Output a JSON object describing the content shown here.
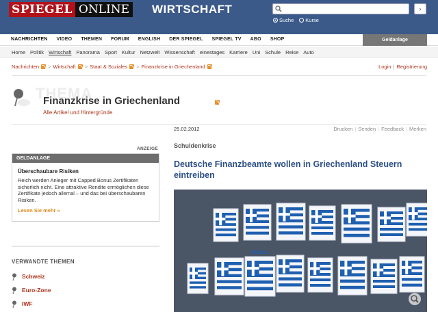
{
  "header": {
    "logo_left": "SPIEGEL",
    "logo_right": "ONLINE",
    "section": "WIRTSCHAFT",
    "search": {
      "placeholder": "",
      "button": "›"
    },
    "radios": [
      {
        "label": "Suche",
        "selected": true
      },
      {
        "label": "Kurse",
        "selected": false
      }
    ]
  },
  "mainnav": {
    "items": [
      "NACHRICHTEN",
      "VIDEO",
      "THEMEN",
      "FORUM",
      "ENGLISH",
      "DER SPIEGEL",
      "SPIEGEL TV",
      "ABO",
      "SHOP"
    ],
    "active": "NACHRICHTEN",
    "right_tab": "Geldanlage"
  },
  "subnav": {
    "items": [
      "Home",
      "Politik",
      "Wirtschaft",
      "Panorama",
      "Sport",
      "Kultur",
      "Netzwelt",
      "Wissenschaft",
      "einestages",
      "Karriere",
      "Uni",
      "Schule",
      "Reise",
      "Auto"
    ],
    "active": "Wirtschaft"
  },
  "breadcrumb": [
    "Nachrichten",
    "Wirtschaft",
    "Staat & Soziales",
    "Finanzkrise in Griechenland"
  ],
  "account": {
    "login": "Login",
    "register": "Registrierung"
  },
  "thema": {
    "badge": "THEMA",
    "title": "Finanzkrise in Griechenland",
    "subtitle": "Alle Artikel und Hintergründe"
  },
  "article_meta": {
    "date": "25.02.2012",
    "tools": [
      "Drucken",
      "Senden",
      "Feedback",
      "Merken"
    ]
  },
  "ad": {
    "label": "ANZEIGE",
    "header": "GELDANLAGE",
    "title": "Überschaubare Risiken",
    "text": "Reich werden Anleger mit Capped Bonus Zertifikaten sicherlich nicht. Eine attraktive Rendite ermöglichen diese Zertifikate jedoch allemal – und das bei überschaubaren Risiken.",
    "more": "Lesen Sie mehr »"
  },
  "related": {
    "heading": "VERWANDTE THEMEN",
    "items": [
      "Schweiz",
      "Euro-Zone",
      "IWF"
    ]
  },
  "article": {
    "kicker": "Schuldenkrise",
    "headline": "Deutsche Finanzbeamte wollen in Griechenland Steuern eintreiben",
    "photo_text": "GREECE"
  },
  "colors": {
    "header_bg": "#3b5a8a",
    "link_red": "#b1341d",
    "headline_blue": "#2c4f86",
    "greek_blue": "#1f5fb0"
  }
}
